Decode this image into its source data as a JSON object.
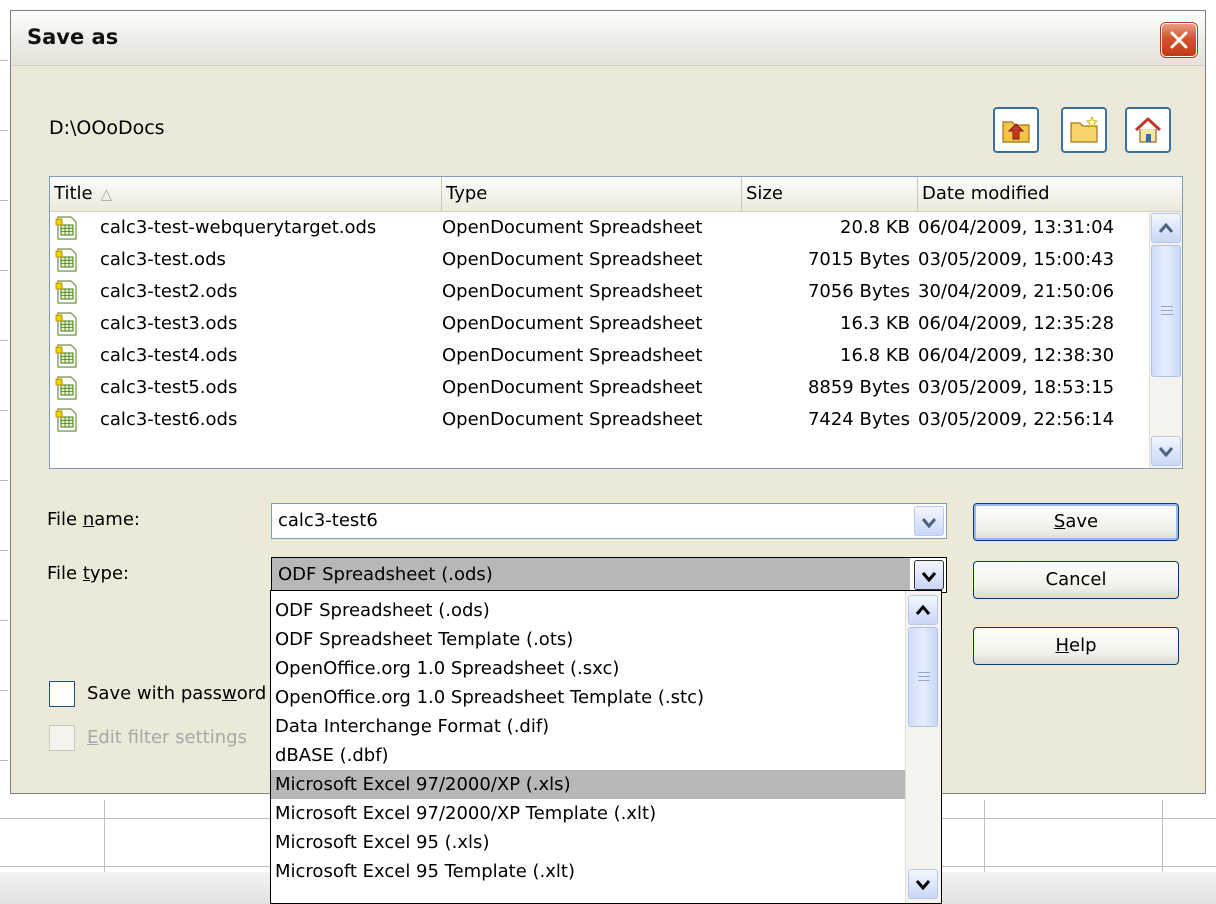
{
  "dialog": {
    "title": "Save as",
    "current_path": "D:\\OOoDocs"
  },
  "toolbar": {
    "buttons": [
      {
        "name": "up-one-level",
        "icon": "folder-up-icon"
      },
      {
        "name": "create-new-folder",
        "icon": "new-folder-icon"
      },
      {
        "name": "default-directory",
        "icon": "home-icon"
      }
    ]
  },
  "file_list": {
    "columns": [
      "Title",
      "Type",
      "Size",
      "Date modified"
    ],
    "sort_indicator": "△",
    "rows": [
      {
        "title": "calc3-test-webquerytarget.ods",
        "type": "OpenDocument Spreadsheet",
        "size": "20.8 KB",
        "date": "06/04/2009, 13:31:04"
      },
      {
        "title": "calc3-test.ods",
        "type": "OpenDocument Spreadsheet",
        "size": "7015 Bytes",
        "date": "03/05/2009, 15:00:43"
      },
      {
        "title": "calc3-test2.ods",
        "type": "OpenDocument Spreadsheet",
        "size": "7056 Bytes",
        "date": "30/04/2009, 21:50:06"
      },
      {
        "title": "calc3-test3.ods",
        "type": "OpenDocument Spreadsheet",
        "size": "16.3 KB",
        "date": "06/04/2009, 12:35:28"
      },
      {
        "title": "calc3-test4.ods",
        "type": "OpenDocument Spreadsheet",
        "size": "16.8 KB",
        "date": "06/04/2009, 12:38:30"
      },
      {
        "title": "calc3-test5.ods",
        "type": "OpenDocument Spreadsheet",
        "size": "8859 Bytes",
        "date": "03/05/2009, 18:53:15"
      },
      {
        "title": "calc3-test6.ods",
        "type": "OpenDocument Spreadsheet",
        "size": "7424 Bytes",
        "date": "03/05/2009, 22:56:14"
      }
    ]
  },
  "form": {
    "file_name_label_pre": "File ",
    "file_name_label_key": "n",
    "file_name_label_post": "ame:",
    "file_name_value": "calc3-test6",
    "file_type_label_pre": "File ",
    "file_type_label_key": "t",
    "file_type_label_post": "ype:",
    "file_type_value": "ODF Spreadsheet (.ods)"
  },
  "buttons": {
    "save_key": "S",
    "save_rest": "ave",
    "cancel": "Cancel",
    "help_key": "H",
    "help_rest": "elp"
  },
  "options": {
    "save_with_password_pre": "Save with pass",
    "save_with_password_key": "w",
    "save_with_password_post": "ord",
    "save_with_password_checked": false,
    "edit_filter_key": "E",
    "edit_filter_rest": "dit filter settings",
    "edit_filter_enabled": false
  },
  "file_type_dropdown": {
    "selected_index": 6,
    "options": [
      "ODF Spreadsheet (.ods)",
      "ODF Spreadsheet Template (.ots)",
      "OpenOffice.org 1.0 Spreadsheet (.sxc)",
      "OpenOffice.org 1.0 Spreadsheet Template (.stc)",
      "Data Interchange Format (.dif)",
      "dBASE (.dbf)",
      "Microsoft Excel 97/2000/XP (.xls)",
      "Microsoft Excel 97/2000/XP Template (.xlt)",
      "Microsoft Excel 95 (.xls)",
      "Microsoft Excel 95 Template (.xlt)"
    ]
  },
  "colors": {
    "dialog_bg": "#ece9d8",
    "close_button": "#d4532c",
    "selection": "#b7b7b7",
    "border_blue": "#7f9db9"
  }
}
